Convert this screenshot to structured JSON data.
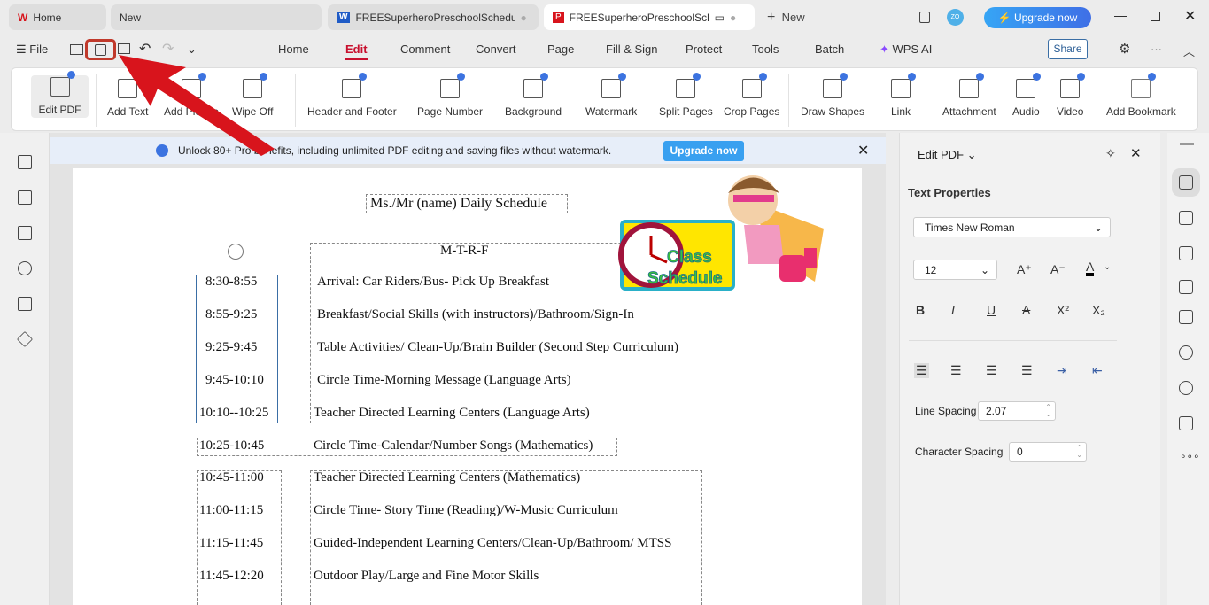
{
  "tabs": [
    {
      "label": "Home"
    },
    {
      "label": "New"
    },
    {
      "label": "FREESuperheroPreschoolSchedule"
    },
    {
      "label": "FREESuperheroPreschoolSche"
    },
    {
      "label": "New"
    }
  ],
  "upgrade_label": "Upgrade now",
  "avatar_initials": "ZO",
  "menu": {
    "file": "File",
    "items": [
      "Home",
      "Edit",
      "Comment",
      "Convert",
      "Page",
      "Fill & Sign",
      "Protect",
      "Tools",
      "Batch"
    ],
    "wps_ai": "WPS AI",
    "share": "Share",
    "active": "Edit"
  },
  "ribbon": [
    "Edit PDF",
    "Add Text",
    "Add Picture",
    "Wipe Off",
    "Header and Footer",
    "Page Number",
    "Background",
    "Watermark",
    "Split Pages",
    "Crop Pages",
    "Draw Shapes",
    "Link",
    "Attachment",
    "Audio",
    "Video",
    "Add Bookmark"
  ],
  "banner": {
    "text": "Unlock 80+ Pro benefits, including unlimited PDF editing and saving files without watermark.",
    "button": "Upgrade now"
  },
  "document": {
    "title": "Ms./Mr (name) Daily Schedule",
    "days": "M-T-R-F",
    "logo_text": "Class Schedule",
    "rows": [
      {
        "time": "8:30-8:55",
        "activity": "Arrival: Car Riders/Bus- Pick Up Breakfast"
      },
      {
        "time": "8:55-9:25",
        "activity": "Breakfast/Social Skills (with instructors)/Bathroom/Sign-In"
      },
      {
        "time": "9:25-9:45",
        "activity": "Table Activities/ Clean-Up/Brain Builder (Second Step Curriculum)"
      },
      {
        "time": "9:45-10:10",
        "activity": "Circle Time-Morning Message (Language Arts)"
      },
      {
        "time": "10:10--10:25",
        "activity": "Teacher Directed Learning Centers (Language Arts)"
      },
      {
        "time": "10:25-10:45",
        "activity": "Circle Time-Calendar/Number Songs (Mathematics)"
      },
      {
        "time": "10:45-11:00",
        "activity": "Teacher Directed Learning Centers (Mathematics)"
      },
      {
        "time": "11:00-11:15",
        "activity": "Circle Time- Story Time (Reading)/W-Music Curriculum"
      },
      {
        "time": "11:15-11:45",
        "activity": "Guided-Independent Learning Centers/Clean-Up/Bathroom/ MTSS"
      },
      {
        "time": "11:45-12:20",
        "activity": "Outdoor Play/Large and Fine Motor Skills"
      }
    ]
  },
  "panel": {
    "title": "Edit PDF",
    "section": "Text Properties",
    "font": "Times New Roman",
    "size": "12",
    "line_spacing_label": "Line Spacing",
    "line_spacing": "2.07",
    "char_spacing_label": "Character Spacing",
    "char_spacing": "0",
    "format": [
      "B",
      "I",
      "U",
      "A",
      "X²",
      "X₂"
    ]
  },
  "colors": {
    "accent": "#c8102e",
    "upgrade": "#2f8cf0",
    "annotation_arrow": "#d8141c"
  }
}
